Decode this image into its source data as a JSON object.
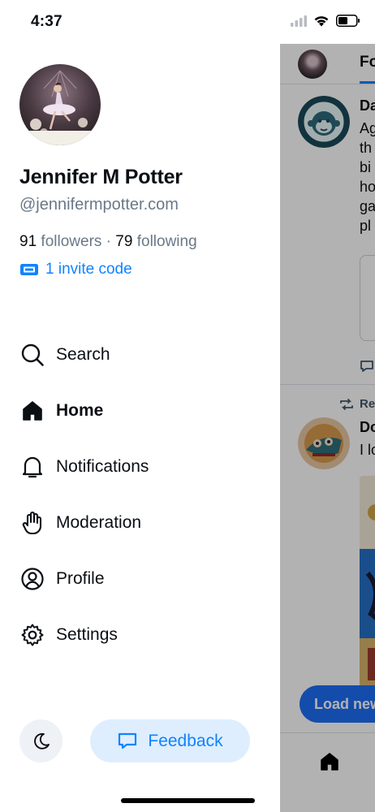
{
  "status_bar": {
    "time": "4:37"
  },
  "drawer": {
    "display_name": "Jennifer M Potter",
    "handle": "@jennifermpotter.com",
    "followers_count": "91",
    "followers_label": "followers",
    "separator": " · ",
    "following_count": "79",
    "following_label": "following",
    "invite_label": "1 invite code",
    "nav": [
      {
        "label": "Search",
        "icon": "search-icon",
        "active": false
      },
      {
        "label": "Home",
        "icon": "home-icon",
        "active": true
      },
      {
        "label": "Notifications",
        "icon": "bell-icon",
        "active": false
      },
      {
        "label": "Moderation",
        "icon": "hand-icon",
        "active": false
      },
      {
        "label": "Profile",
        "icon": "user-circle-icon",
        "active": false
      },
      {
        "label": "Settings",
        "icon": "gear-icon",
        "active": false
      }
    ],
    "feedback_label": "Feedback"
  },
  "feed": {
    "tab_label": "Fo",
    "post1": {
      "author": "Da",
      "lines": [
        "Ag",
        "th",
        "bi",
        "ho",
        "ga",
        "pl"
      ]
    },
    "post2": {
      "repost_label": "Re",
      "author": "Do",
      "lines": [
        "I lo"
      ]
    },
    "load_new_label": "Load new"
  },
  "colors": {
    "accent": "#1083fe",
    "feedback_bg": "#deeefe",
    "load_new_bg": "#1d6ef5",
    "muted_text": "#6b7888"
  }
}
